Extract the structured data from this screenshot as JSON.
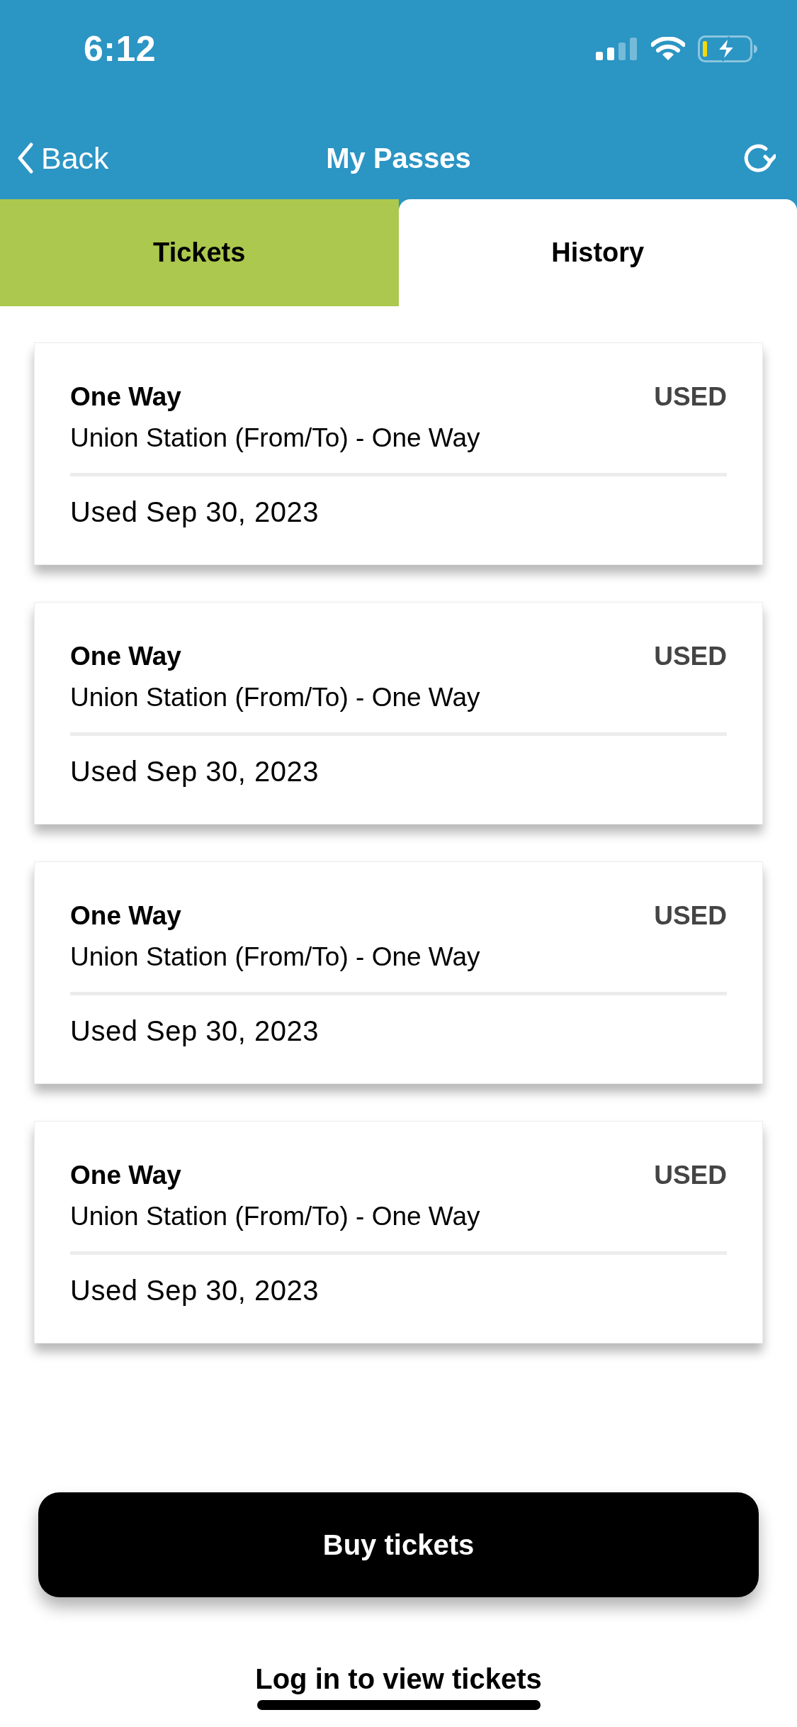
{
  "status_bar": {
    "time": "6:12"
  },
  "nav": {
    "back_label": "Back",
    "title": "My Passes"
  },
  "tabs": [
    {
      "label": "Tickets",
      "selected": false
    },
    {
      "label": "History",
      "selected": true
    }
  ],
  "passes": [
    {
      "title": "One Way",
      "status": "USED",
      "route": "Union Station (From/To) - One Way",
      "used_date": "Used Sep 30, 2023"
    },
    {
      "title": "One Way",
      "status": "USED",
      "route": "Union Station (From/To) - One Way",
      "used_date": "Used Sep 30, 2023"
    },
    {
      "title": "One Way",
      "status": "USED",
      "route": "Union Station (From/To) - One Way",
      "used_date": "Used Sep 30, 2023"
    },
    {
      "title": "One Way",
      "status": "USED",
      "route": "Union Station (From/To) - One Way",
      "used_date": "Used Sep 30, 2023"
    }
  ],
  "buy_button": {
    "label": "Buy tickets"
  },
  "login_link": {
    "label": "Log in to view tickets"
  }
}
